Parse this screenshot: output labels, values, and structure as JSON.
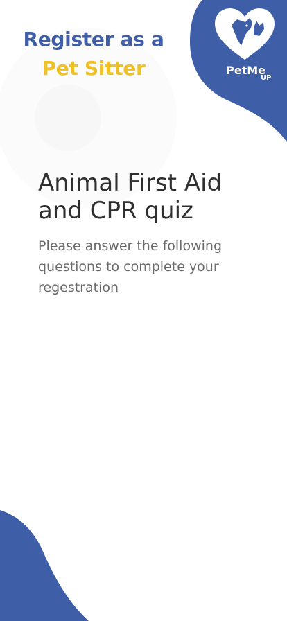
{
  "header": {
    "title_line1": "Register as a",
    "title_line2": "Pet Sitter"
  },
  "logo": {
    "brand": "PetMe",
    "suffix": "UP"
  },
  "quiz": {
    "title": "Animal First Aid and CPR quiz",
    "description": "Please answer the following questions to complete your regestration"
  },
  "colors": {
    "brand_blue": "#3e5ea8",
    "accent_yellow": "#eec126",
    "title_text": "#2f2f2f",
    "body_text": "#6a6a6a"
  },
  "icons": {
    "logo": "heart-dog-cat-icon"
  }
}
